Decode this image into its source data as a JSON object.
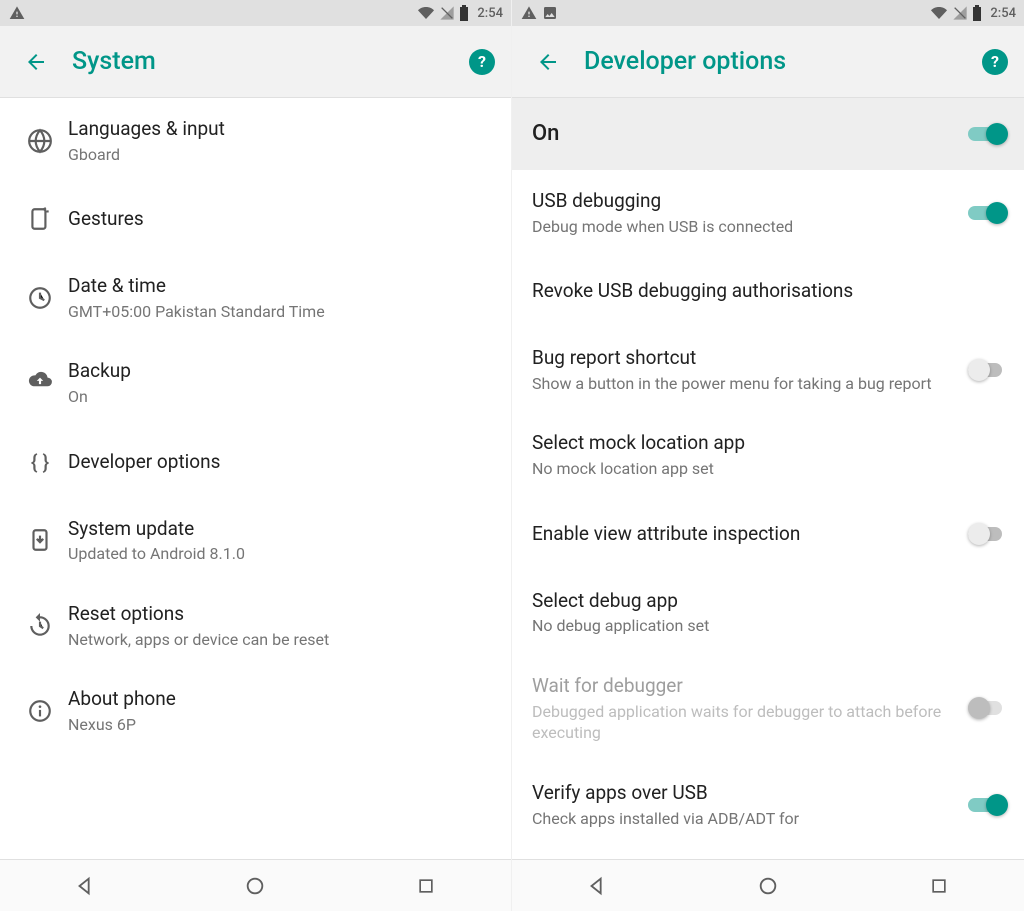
{
  "status": {
    "time": "2:54"
  },
  "left": {
    "title": "System",
    "items": [
      {
        "primary": "Languages & input",
        "secondary": "Gboard"
      },
      {
        "primary": "Gestures",
        "secondary": ""
      },
      {
        "primary": "Date & time",
        "secondary": "GMT+05:00 Pakistan Standard Time"
      },
      {
        "primary": "Backup",
        "secondary": "On"
      },
      {
        "primary": "Developer options",
        "secondary": ""
      },
      {
        "primary": "System update",
        "secondary": "Updated to Android 8.1.0"
      },
      {
        "primary": "Reset options",
        "secondary": "Network, apps or device can be reset"
      },
      {
        "primary": "About phone",
        "secondary": "Nexus 6P"
      }
    ]
  },
  "right": {
    "title": "Developer options",
    "master": "On",
    "items": [
      {
        "primary": "USB debugging",
        "secondary": "Debug mode when USB is connected",
        "toggle": "on"
      },
      {
        "primary": "Revoke USB debugging authorisations",
        "secondary": ""
      },
      {
        "primary": "Bug report shortcut",
        "secondary": "Show a button in the power menu for taking a bug report",
        "toggle": "off"
      },
      {
        "primary": "Select mock location app",
        "secondary": "No mock location app set"
      },
      {
        "primary": "Enable view attribute inspection",
        "secondary": "",
        "toggle": "off"
      },
      {
        "primary": "Select debug app",
        "secondary": "No debug application set"
      },
      {
        "primary": "Wait for debugger",
        "secondary": "Debugged application waits for debugger to attach before executing",
        "toggle": "disabled",
        "disabled": true
      },
      {
        "primary": "Verify apps over USB",
        "secondary": "Check apps installed via ADB/ADT for",
        "toggle": "on"
      }
    ]
  }
}
